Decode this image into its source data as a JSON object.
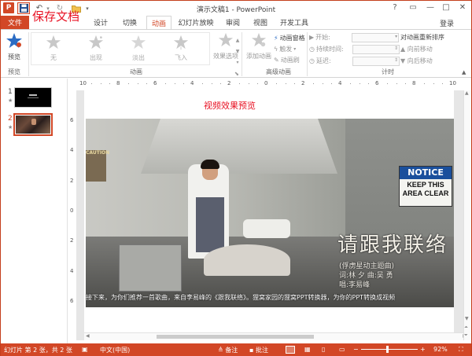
{
  "titlebar": {
    "app_icon_label": "P",
    "window_title": "演示文稿1 - PowerPoint",
    "save_callout": "保存文档"
  },
  "tabs": {
    "file": "文件",
    "items": [
      "设计",
      "切换",
      "动画",
      "幻灯片放映",
      "审阅",
      "视图",
      "开发工具"
    ],
    "active_index": 2,
    "signin": "登录"
  },
  "ribbon": {
    "preview_group": {
      "button": "预览",
      "label": "预览"
    },
    "animation_group": {
      "effects": [
        "无",
        "出现",
        "淡出",
        "飞入"
      ],
      "effect_options": "效果选项",
      "label": "动画"
    },
    "advanced_group": {
      "add_animation": "添加动画",
      "animation_pane": "动画窗格",
      "trigger": "触发",
      "animation_painter": "动画刷",
      "label": "高级动画"
    },
    "timing_group": {
      "start_label": "开始:",
      "duration_label": "持续时间:",
      "delay_label": "延迟:",
      "start_value": "",
      "duration_value": "",
      "delay_value": "",
      "reorder_title": "对动画重新排序",
      "move_earlier": "向前移动",
      "move_later": "向后移动",
      "label": "计时"
    }
  },
  "thumbnails": [
    {
      "number": "1",
      "star": "★"
    },
    {
      "number": "2",
      "star": "★"
    }
  ],
  "ruler": {
    "horizontal": [
      "10",
      "8",
      "6",
      "4",
      "2",
      "0",
      "2",
      "4",
      "6",
      "8",
      "10"
    ],
    "vertical": [
      "6",
      "4",
      "2",
      "0",
      "2",
      "4",
      "6"
    ]
  },
  "slide": {
    "title": "视频效果预览",
    "video": {
      "notice_heading": "NOTICE",
      "notice_text": "KEEP THIS AREA CLEAR",
      "caution_text": "CAUTION",
      "lyrics": "请跟我联络",
      "song_info_1": "(俘虏星动主题曲)",
      "song_info_2": "词:林 夕  曲:吴 勇",
      "song_info_3": "唱:李易峰",
      "subtitle": "接下来，为你们推荐一首歌曲，来自李易峰的《跟我联络》。狸窝家园的狸窝PPT转换器，为你的PPT转换成视频"
    }
  },
  "statusbar": {
    "slide_info": "幻灯片 第 2 张，共 2 张",
    "language": "中文(中国)",
    "notes": "备注",
    "comments": "批注",
    "zoom": "92%"
  },
  "colors": {
    "accent": "#D24726",
    "callout": "#E81123"
  }
}
